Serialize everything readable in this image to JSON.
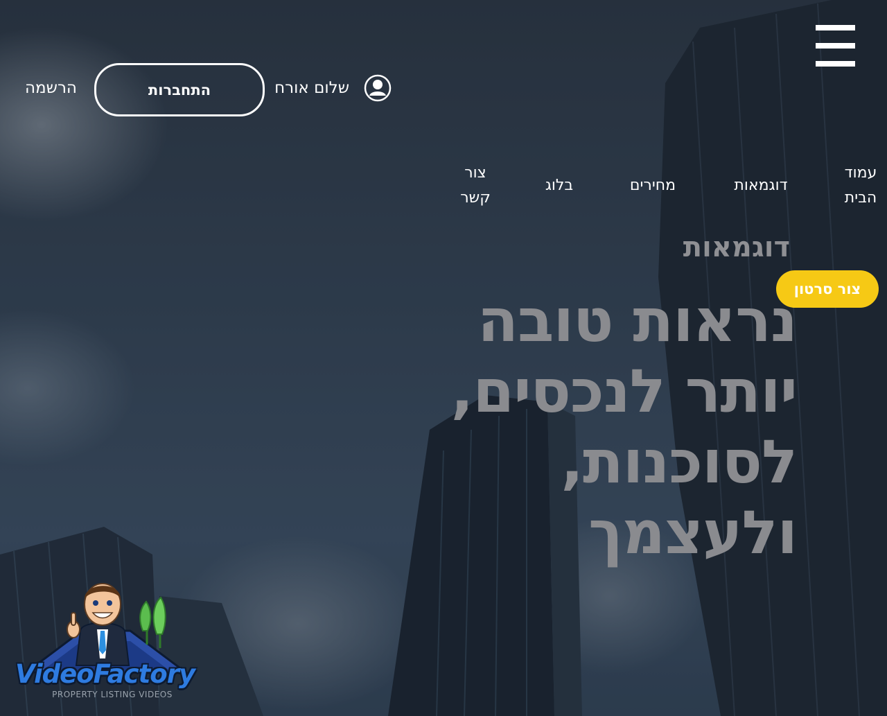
{
  "header": {
    "menu_icon": "hamburger-menu-icon",
    "user_icon": "user-avatar-icon",
    "greeting": "שלום אורח",
    "login_label": "התחברות",
    "register_label": "הרשמה"
  },
  "nav": {
    "items": [
      {
        "label": "עמוד הבית"
      },
      {
        "label": "דוגמאות"
      },
      {
        "label": "מחירים"
      },
      {
        "label": "בלוג"
      },
      {
        "label": "צור קשר"
      }
    ]
  },
  "hero": {
    "section_label": "דוגמאות",
    "headline_lines": [
      "נראות טובה",
      "יותר לנכסים,",
      "לסוכנות,",
      "ולעצמך"
    ],
    "cta_label": "צור סרטון",
    "headline_color": "#8a8b8f",
    "cta_color": "#f6c915"
  },
  "logo": {
    "name": "VideoFactory",
    "tagline": "PROPERTY LISTING VIDEOS"
  }
}
